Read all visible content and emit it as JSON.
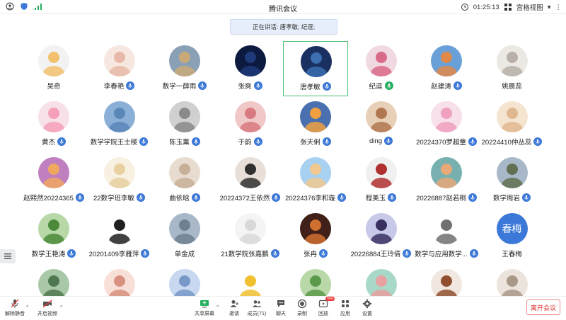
{
  "titlebar": {
    "title": "腾讯会议",
    "time": "01:25:13",
    "view_label": "宫格视图"
  },
  "speaking": {
    "label": "正在讲话: 唐孝敏; 纪逗;"
  },
  "participants": [
    {
      "name": "吴奇",
      "mic": false,
      "color": "#f3c16e",
      "bg": "#f2f2f2"
    },
    {
      "name": "李春艳",
      "mic": true,
      "color": "#e8b9a8",
      "bg": "#f6e8e0"
    },
    {
      "name": "数学一薛雨",
      "mic": true,
      "color": "#c9a97a",
      "bg": "#8aa0b5"
    },
    {
      "name": "张爽",
      "mic": true,
      "color": "#1f3a7a",
      "bg": "#0d1a40"
    },
    {
      "name": "唐孝敏",
      "mic": true,
      "color": "#3b6fb0",
      "bg": "#1a3060",
      "active": true
    },
    {
      "name": "纪逗",
      "mic": true,
      "mic_green": true,
      "color": "#d96a8a",
      "bg": "#f0d9e0"
    },
    {
      "name": "赵建涛",
      "mic": true,
      "color": "#e08a4a",
      "bg": "#6aa0d8"
    },
    {
      "name": "姚晨蕊",
      "mic": false,
      "color": "#b8b0a8",
      "bg": "#ece8e4"
    },
    {
      "name": "黄杰",
      "mic": true,
      "color": "#f4a0b8",
      "bg": "#f7e0e8"
    },
    {
      "name": "数学学院王士楔",
      "mic": true,
      "color": "#5a86b8",
      "bg": "#8ab0d8"
    },
    {
      "name": "陈玉薰",
      "mic": true,
      "color": "#8a8a8a",
      "bg": "#d0d0d0"
    },
    {
      "name": "于韵",
      "mic": true,
      "color": "#d87a80",
      "bg": "#f0c8c8"
    },
    {
      "name": "张天俐",
      "mic": true,
      "color": "#f0a040",
      "bg": "#4a70b0"
    },
    {
      "name": "ding",
      "mic": true,
      "color": "#b07850",
      "bg": "#e8d0b8"
    },
    {
      "name": "20224370罗超童",
      "mic": true,
      "color": "#f0a0c0",
      "bg": "#f8e0ea"
    },
    {
      "name": "20224410仲丛蕊",
      "mic": true,
      "color": "#e0b890",
      "bg": "#f4e4d0"
    },
    {
      "name": "赵熙然20224365",
      "mic": true,
      "color": "#f0a860",
      "bg": "#c080c0"
    },
    {
      "name": "22数学班李敏",
      "mic": true,
      "color": "#e8d0a0",
      "bg": "#f8f0e0"
    },
    {
      "name": "曲依晗",
      "mic": true,
      "color": "#c8b098",
      "bg": "#e8dcd0"
    },
    {
      "name": "20224372王依然",
      "mic": true,
      "color": "#303030",
      "bg": "#e8e0d8"
    },
    {
      "name": "20224376李和璇",
      "mic": true,
      "color": "#f0c890",
      "bg": "#a8d0f0"
    },
    {
      "name": "程美玉",
      "mic": true,
      "color": "#b03030",
      "bg": "#f0f0f0"
    },
    {
      "name": "20226887赵若桐",
      "mic": true,
      "color": "#e8a878",
      "bg": "#78b0b0"
    },
    {
      "name": "数学周岩",
      "mic": true,
      "color": "#607050",
      "bg": "#a8b8c8"
    },
    {
      "name": "数学王艳涛",
      "mic": true,
      "color": "#4a8a3a",
      "bg": "#b8d8a8"
    },
    {
      "name": "20201409李雁萍",
      "mic": true,
      "color": "#202020",
      "bg": "#ffffff"
    },
    {
      "name": "单金成",
      "mic": false,
      "color": "#708090",
      "bg": "#a8b8c8"
    },
    {
      "name": "21数学院张嘉鹏",
      "mic": true,
      "color": "#d8d8d8",
      "bg": "#f4f4f4"
    },
    {
      "name": "张冉",
      "mic": true,
      "color": "#d07030",
      "bg": "#402018"
    },
    {
      "name": "20226884王玲倩",
      "mic": true,
      "color": "#3a3060",
      "bg": "#c8c8e8"
    },
    {
      "name": "数学与应用数学...",
      "mic": true,
      "color": "#707070",
      "bg": "#ffffff"
    },
    {
      "name": "王春梅",
      "mic": false,
      "text_avatar": "春梅"
    },
    {
      "name": "",
      "mic": false,
      "color": "#507850",
      "bg": "#a8c8a8"
    },
    {
      "name": "",
      "mic": false,
      "color": "#d89080",
      "bg": "#f8e0d8"
    },
    {
      "name": "",
      "mic": false,
      "color": "#7898c8",
      "bg": "#c8d8f0"
    },
    {
      "name": "",
      "mic": false,
      "color": "#f0c030",
      "bg": "#ffffff"
    },
    {
      "name": "",
      "mic": false,
      "color": "#5a9a4a",
      "bg": "#b8d8a8"
    },
    {
      "name": "",
      "mic": false,
      "color": "#e8a0a0",
      "bg": "#a8d8c8"
    },
    {
      "name": "",
      "mic": false,
      "color": "#905030",
      "bg": "#f0e8e0"
    },
    {
      "name": "",
      "mic": false,
      "color": "#a89888",
      "bg": "#ece4dc"
    }
  ],
  "toolbar": {
    "unmute": "解除静音",
    "start_video": "开启视频",
    "share": "共享屏幕",
    "invite": "邀请",
    "members": "成员(71)",
    "chat": "聊天",
    "record": "录制",
    "replay": "回放",
    "apps": "应用",
    "settings": "设置",
    "new_badge": "new",
    "leave": "离开会议"
  }
}
